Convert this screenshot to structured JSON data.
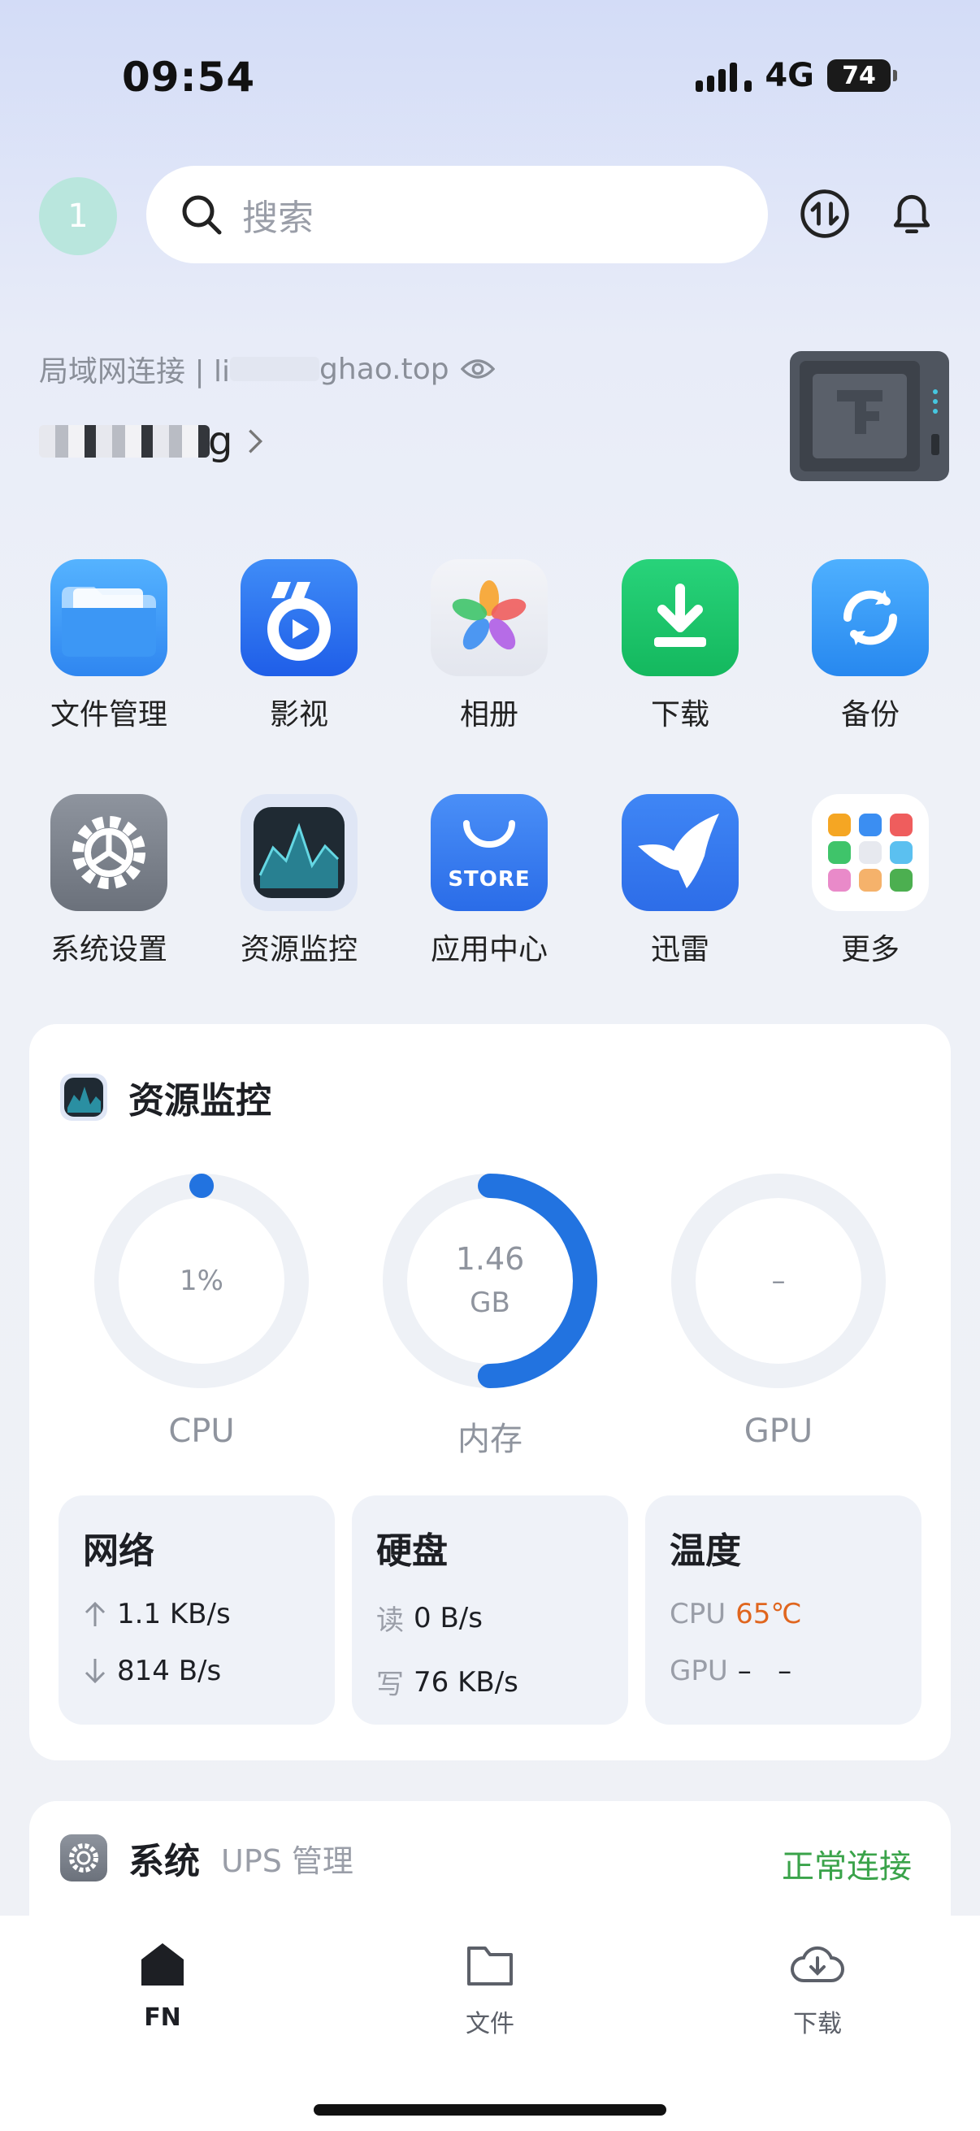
{
  "status_bar": {
    "time": "09:54",
    "network": "4G",
    "battery": "74"
  },
  "header": {
    "avatar_text": "1",
    "search_placeholder": "搜索"
  },
  "connection": {
    "mode_text": "局域网连接 | li",
    "domain_text": "ghao.top",
    "device_name_end": "g"
  },
  "apps": [
    {
      "label": "文件管理",
      "icon": "folder-icon"
    },
    {
      "label": "影视",
      "icon": "video-icon"
    },
    {
      "label": "相册",
      "icon": "photos-icon"
    },
    {
      "label": "下载",
      "icon": "download-icon"
    },
    {
      "label": "备份",
      "icon": "backup-icon"
    },
    {
      "label": "系统设置",
      "icon": "settings-icon"
    },
    {
      "label": "资源监控",
      "icon": "monitor-icon"
    },
    {
      "label": "应用中心",
      "icon": "store-icon"
    },
    {
      "label": "迅雷",
      "icon": "xunlei-icon"
    },
    {
      "label": "更多",
      "icon": "more-icon"
    }
  ],
  "store_badge": "STORE",
  "monitor": {
    "title": "资源监控",
    "gauges": [
      {
        "label": "CPU",
        "value": "1%",
        "fraction": 0.01
      },
      {
        "label": "内存",
        "value": "1.46",
        "unit": "GB",
        "fraction": 0.5
      },
      {
        "label": "GPU",
        "value": "–",
        "fraction": 0
      }
    ],
    "network": {
      "title": "网络",
      "up": "1.1 KB/s",
      "down": "814 B/s"
    },
    "disk": {
      "title": "硬盘",
      "read_label": "读",
      "read": "0 B/s",
      "write_label": "写",
      "write": "76 KB/s"
    },
    "temperature": {
      "title": "温度",
      "cpu_label": "CPU",
      "cpu": "65℃",
      "gpu_label": "GPU",
      "gpu": "–   –"
    }
  },
  "system": {
    "title": "系统",
    "subtitle": "UPS 管理",
    "status": "正常连接",
    "status_color": "#3aa34a"
  },
  "nav": [
    {
      "label": "FN",
      "icon": "home-icon",
      "active": true
    },
    {
      "label": "文件",
      "icon": "folder-outline-icon",
      "active": false
    },
    {
      "label": "下载",
      "icon": "download-cloud-icon",
      "active": false
    }
  ]
}
